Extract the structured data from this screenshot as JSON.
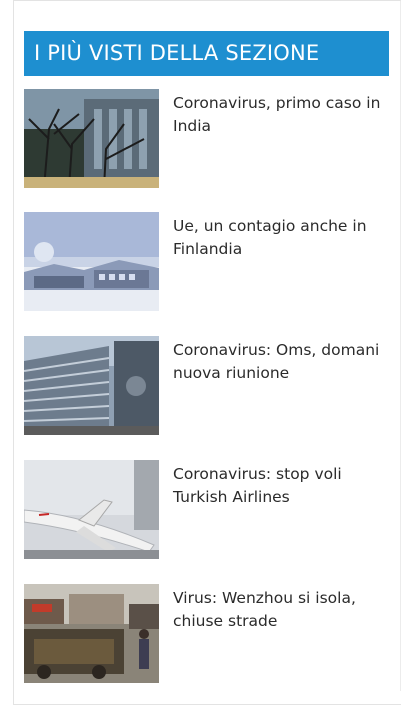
{
  "section": {
    "title": "I PIÙ VISTI DELLA SEZIONE"
  },
  "items": [
    {
      "title": "Coronavirus, primo caso in India",
      "image": "city-building-trees"
    },
    {
      "title": "Ue, un contagio anche in Finlandia",
      "image": "winter-buildings"
    },
    {
      "title": "Coronavirus: Oms, domani nuova riunione",
      "image": "office-building"
    },
    {
      "title": "Coronavirus: stop voli Turkish Airlines",
      "image": "airplane"
    },
    {
      "title": "Virus: Wenzhou si isola, chiuse strade",
      "image": "street-scene"
    }
  ],
  "colors": {
    "header_bg": "#1e8fd0",
    "header_text": "#ffffff",
    "item_text": "#2b2b2b"
  }
}
